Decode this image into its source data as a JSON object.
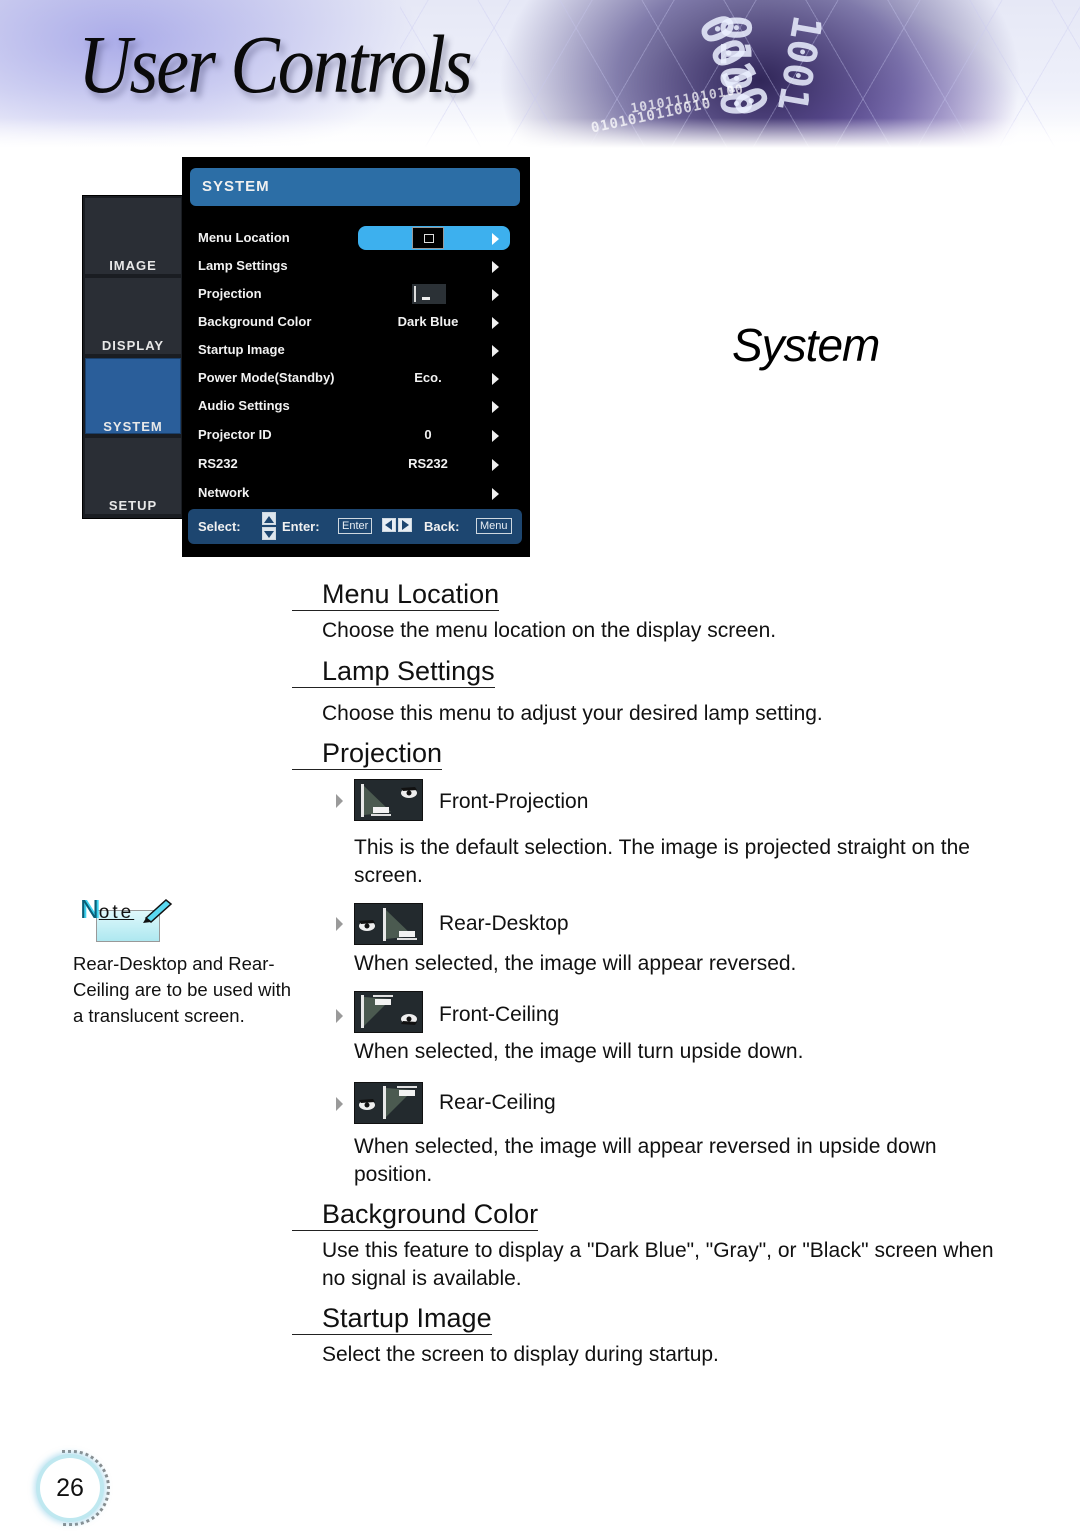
{
  "header": {
    "title": "User Controls",
    "binary_decor": [
      "0010",
      "0100",
      "1001",
      "0101010110010",
      "1010111010100"
    ]
  },
  "section_title": "System",
  "osd_menu": {
    "sidebar_tabs": [
      {
        "label": "IMAGE",
        "active": false
      },
      {
        "label": "DISPLAY",
        "active": false
      },
      {
        "label": "SYSTEM",
        "active": true
      },
      {
        "label": "SETUP",
        "active": false
      }
    ],
    "header": "SYSTEM",
    "items": [
      {
        "label": "Menu Location",
        "value": "",
        "value_icon": "menu-location-center-icon",
        "selected": true
      },
      {
        "label": "Lamp Settings",
        "value": "",
        "selected": false
      },
      {
        "label": "Projection",
        "value": "",
        "value_icon": "front-projection-icon",
        "selected": false
      },
      {
        "label": "Background Color",
        "value": "Dark Blue",
        "selected": false
      },
      {
        "label": "Startup Image",
        "value": "",
        "selected": false
      },
      {
        "label": "Power Mode(Standby)",
        "value": "Eco.",
        "selected": false
      },
      {
        "label": "Audio Settings",
        "value": "",
        "selected": false
      },
      {
        "label": "Projector ID",
        "value": "0",
        "selected": false
      },
      {
        "label": "RS232",
        "value": "RS232",
        "selected": false
      },
      {
        "label": "Network",
        "value": "",
        "selected": false
      }
    ],
    "footer": {
      "select_label": "Select:",
      "enter_label": "Enter:",
      "enter_key": "Enter",
      "back_label": "Back:",
      "back_key": "Menu"
    }
  },
  "sections": {
    "menu_location": {
      "title": "Menu Location",
      "text": "Choose the menu location on the display screen."
    },
    "lamp_settings": {
      "title": "Lamp Settings",
      "text": "Choose this menu to adjust your desired lamp setting."
    },
    "projection": {
      "title": "Projection",
      "options": [
        {
          "label": "Front-Projection",
          "icon": "front-projection-icon",
          "text": "This is the default selection. The image is projected straight on the screen."
        },
        {
          "label": "Rear-Desktop",
          "icon": "rear-desktop-icon",
          "text": "When selected, the image will appear reversed."
        },
        {
          "label": "Front-Ceiling",
          "icon": "front-ceiling-icon",
          "text": "When selected, the image will turn upside down."
        },
        {
          "label": "Rear-Ceiling",
          "icon": "rear-ceiling-icon",
          "text": "When selected, the image will appear reversed in upside down position."
        }
      ]
    },
    "background_color": {
      "title": "Background Color",
      "text": "Use this feature to display a \"Dark Blue\", \"Gray\", or \"Black\" screen when no signal is available."
    },
    "startup_image": {
      "title": "Startup Image",
      "text": "Select the screen to display during startup."
    }
  },
  "note": {
    "heading_first": "N",
    "heading_rest": "ote",
    "text": "Rear-Desktop and Rear-Ceiling are to be used with a translucent screen."
  },
  "page_number": "26",
  "colors": {
    "osd_header": "#2c6ea6",
    "osd_highlight": "#3db0ee",
    "osd_footer": "#1d4670",
    "sidebar_active": "#2a5e9a"
  }
}
